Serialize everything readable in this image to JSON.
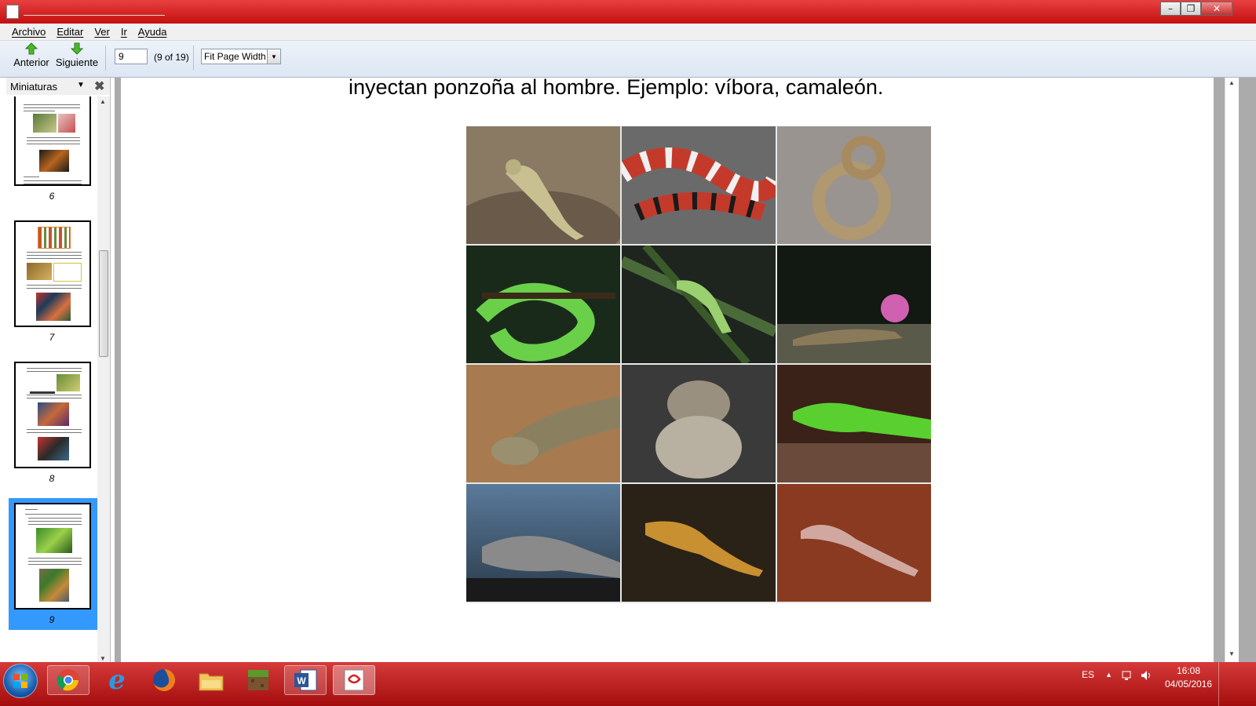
{
  "menu": {
    "items": [
      "Archivo",
      "Editar",
      "Ver",
      "Ir",
      "Ayuda"
    ]
  },
  "toolbar": {
    "prev_label": "Anterior",
    "next_label": "Siguiente",
    "page_value": "9",
    "page_count": "(9 of 19)",
    "zoom_value": "Fit Page Width"
  },
  "sidebar": {
    "title": "Miniaturas",
    "pages": [
      "6",
      "7",
      "8",
      "9"
    ],
    "selected_page": "9"
  },
  "document": {
    "text": "inyectan ponzoña al hombre. Ejemplo: víbora, camaleón."
  },
  "taskbar": {
    "apps": [
      "windows-start",
      "chrome",
      "internet-explorer",
      "firefox",
      "file-explorer",
      "minecraft",
      "word",
      "pdf-reader"
    ],
    "language": "ES",
    "time": "16:08",
    "date": "04/05/2016"
  },
  "colors": {
    "title_bar": "#d42020",
    "selection": "#3399ff",
    "toolbar_bg": "#e4ebf5"
  }
}
